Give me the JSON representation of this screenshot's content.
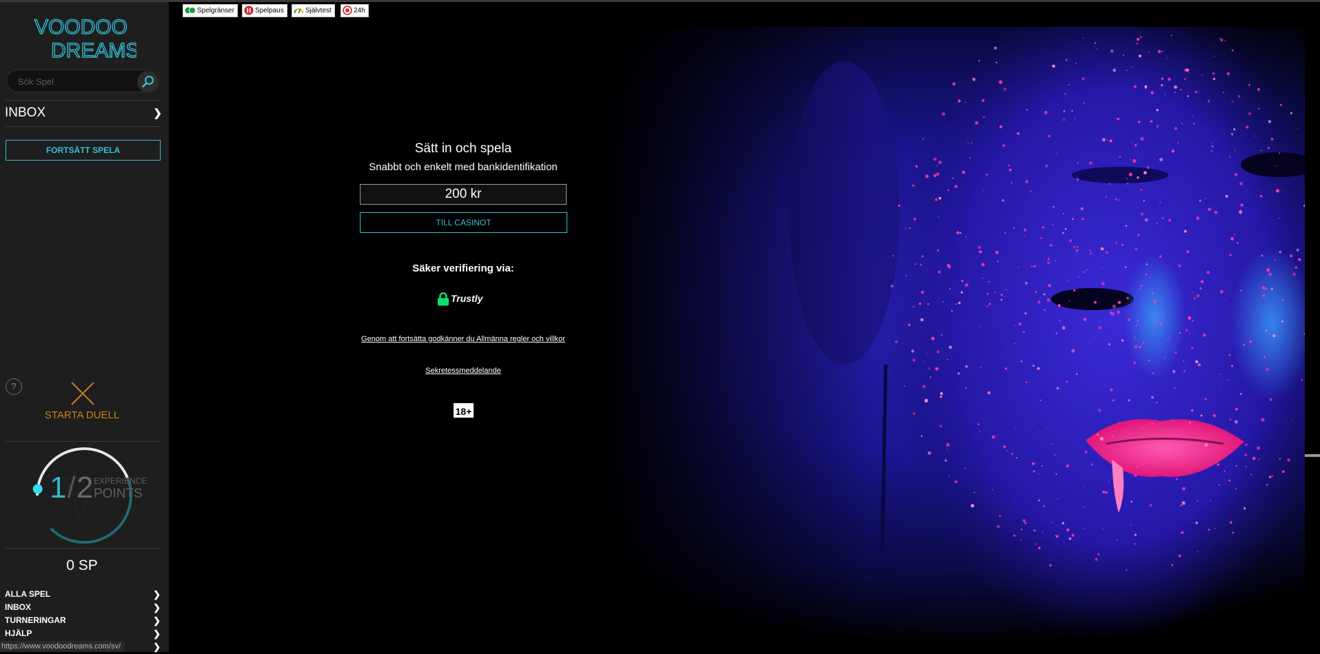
{
  "sidebar": {
    "logo": {
      "line1": "VOODOO",
      "line2": "DREAMS",
      "color": "#33c8dc"
    },
    "search": {
      "placeholder": "Sök Spel",
      "icon": "search-icon"
    },
    "inbox_label": "INBOX",
    "continue_label": "FORTSÄTT SPELA",
    "help_label": "?",
    "duel_label": "STARTA DUELL",
    "xp": {
      "current": "1",
      "separator": "/",
      "total": "2",
      "label_small": "EXPERIENCE",
      "label_big": "POINTS",
      "progress": 0.5
    },
    "sp_label": "0 SP",
    "nav": [
      {
        "label": "ALLA SPEL"
      },
      {
        "label": "INBOX"
      },
      {
        "label": "TURNERINGAR"
      },
      {
        "label": "HJÄLP"
      }
    ],
    "status_url": "https://www.voodoodreams.com/sv/"
  },
  "toolbar": {
    "badges": [
      {
        "label": "Spelgränser",
        "icon": "limits-icon"
      },
      {
        "label": "Spelpaus",
        "icon": "pause-icon"
      },
      {
        "label": "Självtest",
        "icon": "gauge-icon"
      },
      {
        "label": "24h",
        "icon": "stop-icon"
      }
    ]
  },
  "main": {
    "heading": "Sätt in och spela",
    "subheading": "Snabbt och enkelt med bankidentifikation",
    "amount_value": "200 kr",
    "cta_label": "TILL CASINOT",
    "secure_label": "Säker verifiering via:",
    "provider": "Trustly",
    "terms_text": "Genom att fortsätta godkänner du Allmänna regler och villkor",
    "privacy_text": "Sekretessmeddelande",
    "age_label": "18+"
  },
  "colors": {
    "accent": "#32c3d6",
    "duel": "#c8821a",
    "trustly": "#0ee06e",
    "sidebar_bg": "#1e1e1e"
  }
}
